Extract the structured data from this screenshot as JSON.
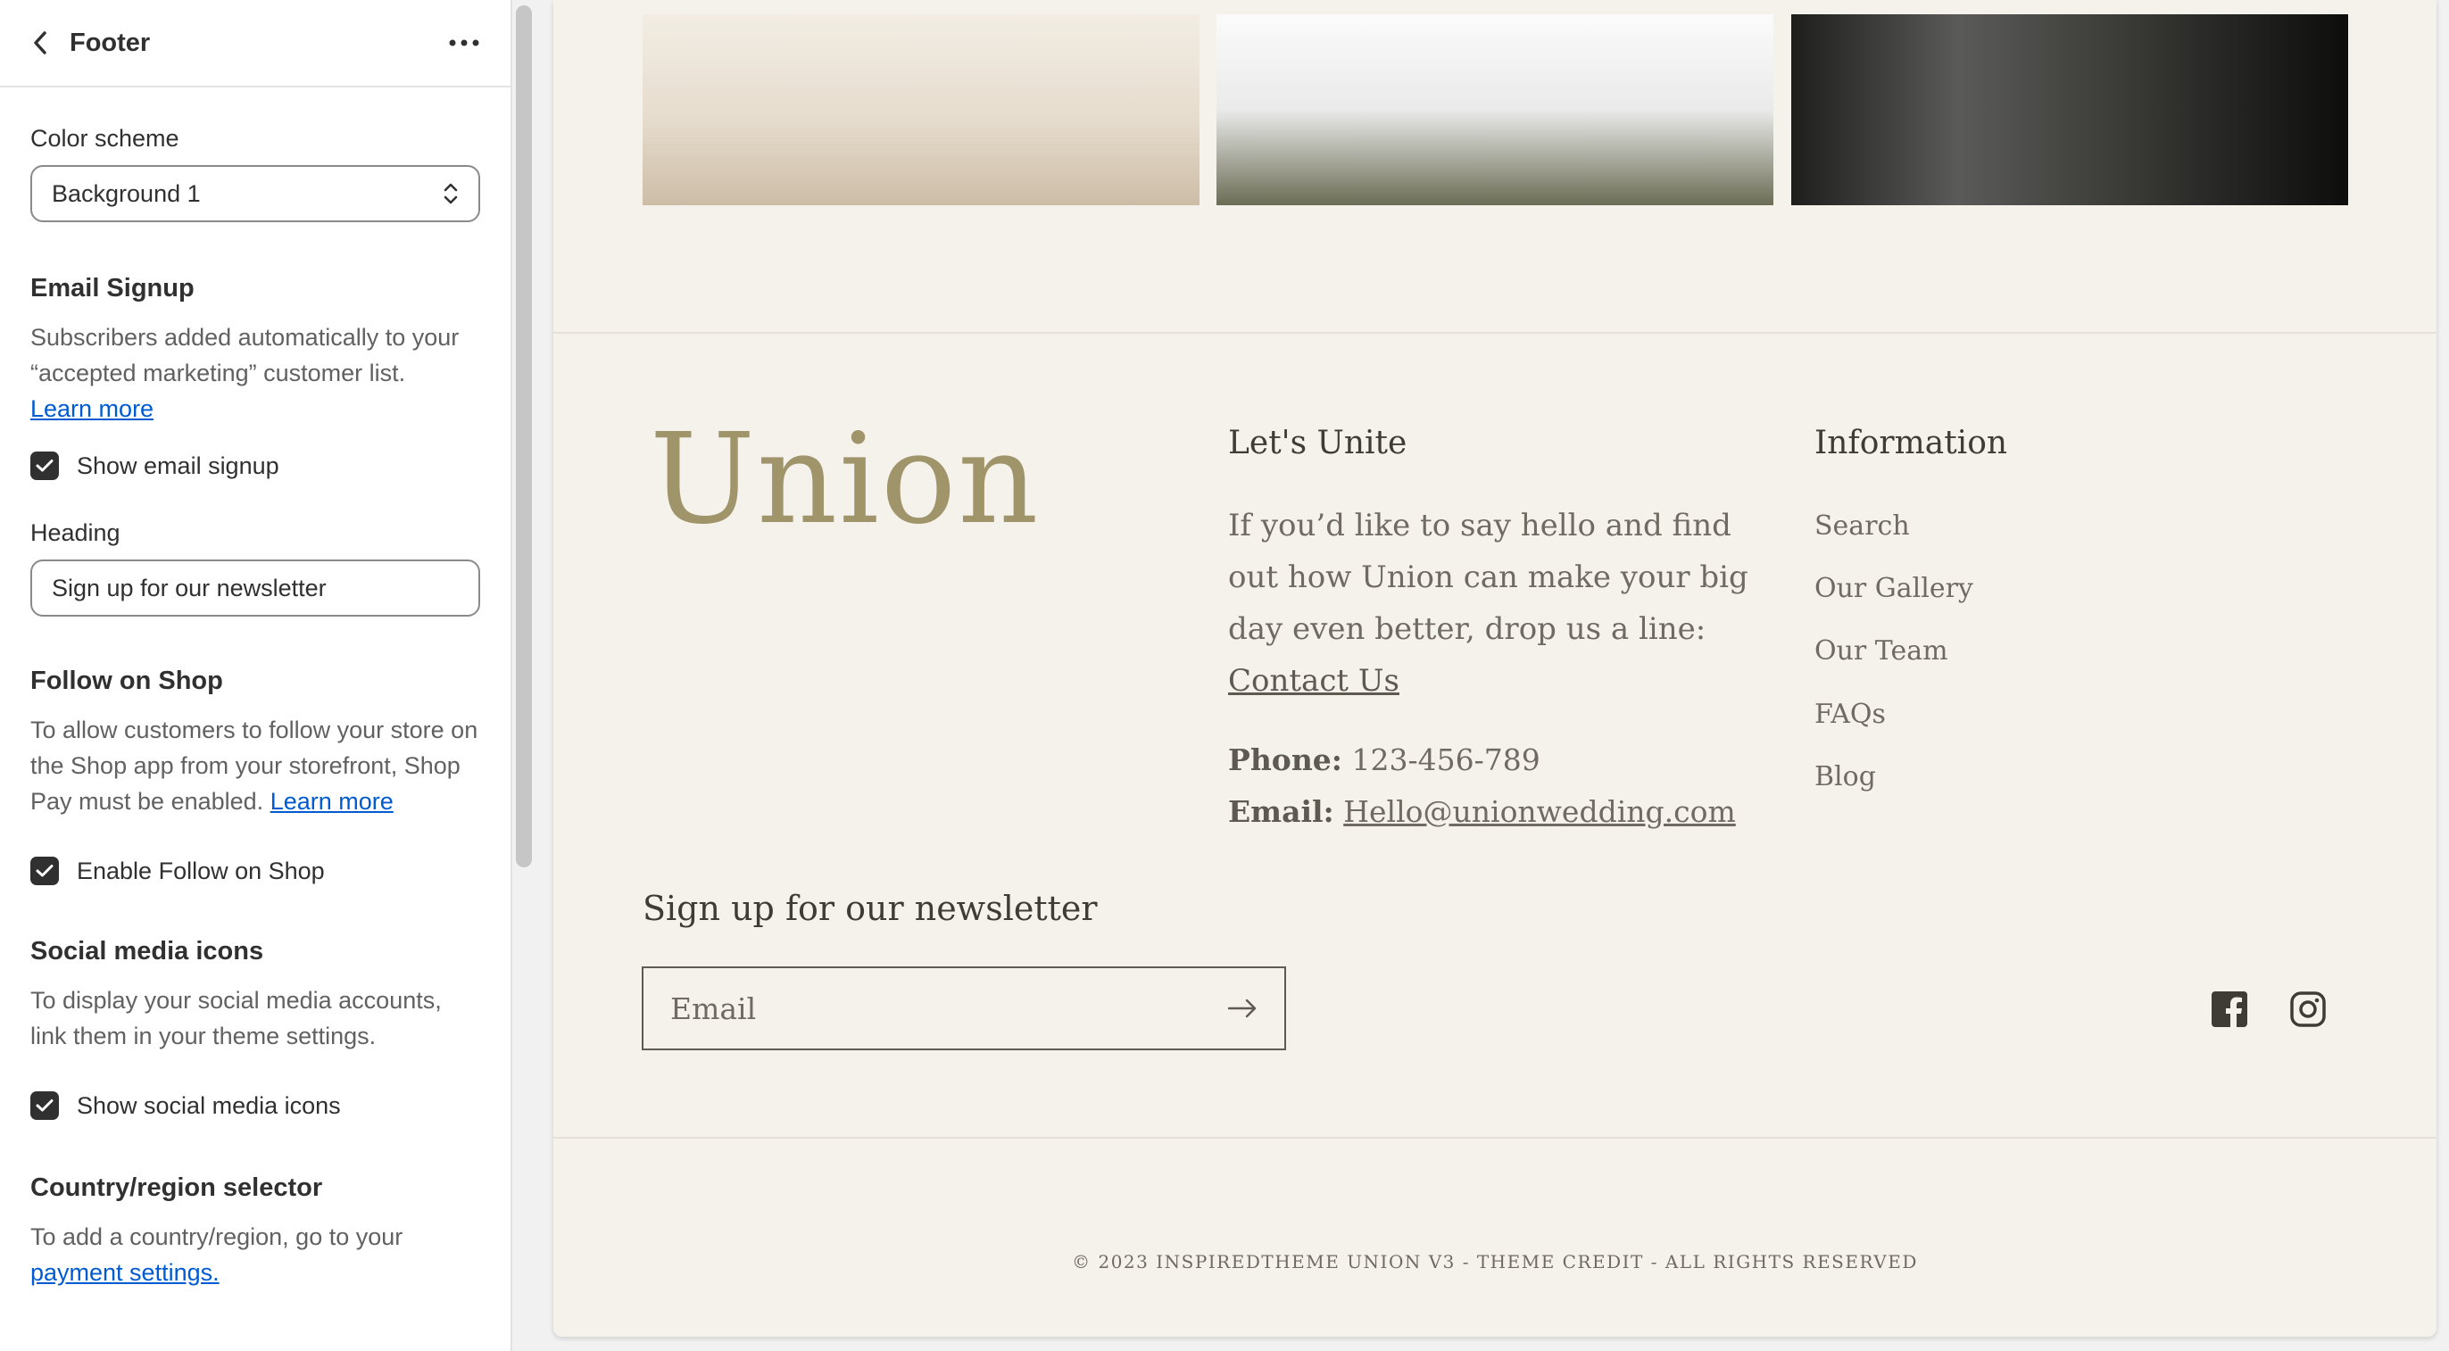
{
  "panel": {
    "title": "Footer",
    "color_scheme_label": "Color scheme",
    "color_scheme_value": "Background 1",
    "email_signup": {
      "heading": "Email Signup",
      "desc": "Subscribers added automatically to your “accepted marketing” customer list.",
      "learn_more": "Learn more",
      "checkbox_label": "Show email signup",
      "checked": true
    },
    "heading_label": "Heading",
    "heading_value": "Sign up for our newsletter",
    "follow_shop": {
      "heading": "Follow on Shop",
      "desc": "To allow customers to follow your store on the Shop app from your storefront, Shop Pay must be enabled.",
      "learn_more": "Learn more",
      "checkbox_label": "Enable Follow on Shop",
      "checked": true
    },
    "social": {
      "heading": "Social media icons",
      "desc": "To display your social media accounts, link them in your theme settings.",
      "checkbox_label": "Show social media icons",
      "checked": true
    },
    "country": {
      "heading": "Country/region selector",
      "desc": "To add a country/region, go to your",
      "link": "payment settings."
    }
  },
  "preview": {
    "logo": "Union",
    "lets_unite": {
      "title": "Let's Unite",
      "text": "If you’d like to say hello and find out how Union can make your big day even better, drop us a line:",
      "contact_link": "Contact Us",
      "phone_label": "Phone:",
      "phone": "123-456-789",
      "email_label": "Email:",
      "email": "Hello@unionwedding.com"
    },
    "information": {
      "title": "Information",
      "links": [
        "Search",
        "Our Gallery",
        "Our Team",
        "FAQs",
        "Blog"
      ]
    },
    "newsletter": {
      "heading": "Sign up for our newsletter",
      "placeholder": "Email"
    },
    "social_icons": [
      "facebook-icon",
      "instagram-icon"
    ],
    "copyright": "© 2023 INSPIREDTHEME UNION V3 - THEME CREDIT - ALL RIGHTS RESERVED"
  },
  "colors": {
    "preview_bg": "#f5f2ec",
    "logo": "#a0946b",
    "link_blue": "#005bd3",
    "checkbox": "#303030"
  }
}
